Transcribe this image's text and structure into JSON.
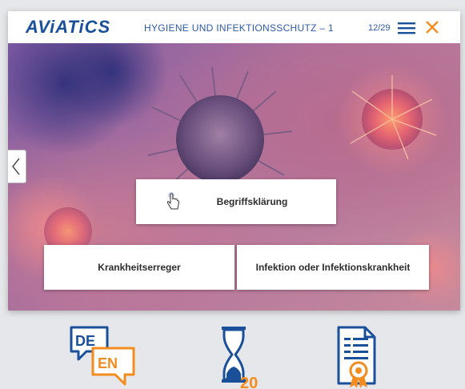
{
  "header": {
    "logo_text": "AViATiCS",
    "course_title": "HYGIENE UND INFEKTIONSSCHUTZ – 1",
    "page_counter": "12/29"
  },
  "cards": {
    "top": "Begriffsklärung",
    "bottom_left": "Krankheitserreger",
    "bottom_right": "Infektion oder Infektionskrankheit"
  },
  "footer": {
    "lang_primary": "DE",
    "lang_secondary": "EN",
    "duration_minutes": "20"
  },
  "colors": {
    "brand_blue": "#1a4f9a",
    "accent_orange": "#f28c1e",
    "close_orange": "#f28c1e"
  },
  "icons": {
    "menu": "menu-icon",
    "close": "close-icon",
    "back": "chevron-left-icon",
    "cursor": "hand-pointer-icon",
    "language": "language-switch-icon",
    "duration": "hourglass-icon",
    "certificate": "certificate-icon"
  }
}
